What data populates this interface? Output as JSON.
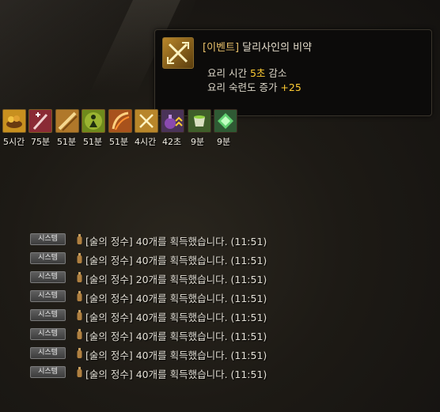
{
  "tooltip": {
    "title_tag": "[이벤트]",
    "title_name": "달리사인의 비약",
    "line1_prefix": "요리 시간 ",
    "line1_value": "5초",
    "line1_suffix": " 감소",
    "line2_prefix": "요리 숙련도 증가 ",
    "line2_value": "+25",
    "icon": "crossed-pickaxe-icon"
  },
  "buffs": [
    {
      "icon": "food-bowl-icon",
      "label": "5시간",
      "color": "#c8901f"
    },
    {
      "icon": "sword-heal-icon",
      "label": "75분",
      "color": "#8a2a35"
    },
    {
      "icon": "brush-icon",
      "label": "51분",
      "color": "#b0782a"
    },
    {
      "icon": "figure-aura-icon",
      "label": "51분",
      "color": "#6f8a1c"
    },
    {
      "icon": "slash-icon",
      "label": "51분",
      "color": "#a8521c"
    },
    {
      "icon": "crossed-pickaxe-icon",
      "label": "4시간",
      "color": "#b8862a"
    },
    {
      "icon": "potion-purple-icon",
      "label": "42초",
      "color": "#4a3358"
    },
    {
      "icon": "cup-green-icon",
      "label": "9분",
      "color": "#3f5e2a"
    },
    {
      "icon": "gem-green-icon",
      "label": "9분",
      "color": "#2f5a34"
    }
  ],
  "chat": {
    "system_label": "시스템",
    "messages": [
      "[술의 정수] 40개를 획득했습니다. (11:51)",
      "[술의 정수] 40개를 획득했습니다. (11:51)",
      "[술의 정수] 20개를 획득했습니다. (11:51)",
      "[술의 정수] 40개를 획득했습니다. (11:51)",
      "[술의 정수] 40개를 획득했습니다. (11:51)",
      "[술의 정수] 40개를 획득했습니다. (11:51)",
      "[술의 정수] 40개를 획득했습니다. (11:51)",
      "[술의 정수] 40개를 획득했습니다. (11:51)"
    ]
  }
}
